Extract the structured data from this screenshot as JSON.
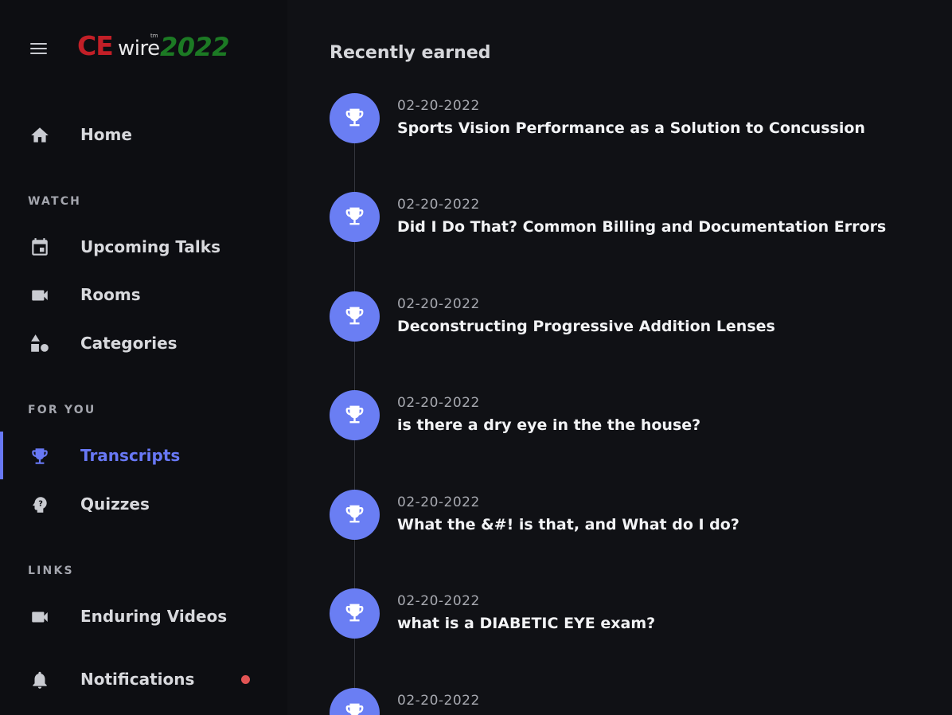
{
  "logo": {
    "ce": "CE",
    "wire": "wire",
    "tm": "tm",
    "year": "2022"
  },
  "sidebar": {
    "home": "Home",
    "sections": {
      "watch": "WATCH",
      "for_you": "FOR YOU",
      "links": "LINKS"
    },
    "items": {
      "upcoming": "Upcoming Talks",
      "rooms": "Rooms",
      "categories": "Categories",
      "transcripts": "Transcripts",
      "quizzes": "Quizzes",
      "enduring": "Enduring Videos",
      "notifications": "Notifications"
    },
    "active_item": "Transcripts",
    "icons": {
      "menu": "menu-icon",
      "home": "home-icon",
      "calendar": "calendar-icon",
      "video": "video-camera-icon",
      "categories": "shapes-icon",
      "trophy": "trophy-icon",
      "quiz": "question-head-icon",
      "bell": "bell-icon"
    }
  },
  "main": {
    "title": "Recently earned",
    "entries": [
      {
        "date": "02-20-2022",
        "title": "Sports Vision Performance as a Solution to Concussion"
      },
      {
        "date": "02-20-2022",
        "title": "Did I Do That? Common Billing and Documentation Errors"
      },
      {
        "date": "02-20-2022",
        "title": "Deconstructing Progressive Addition Lenses"
      },
      {
        "date": "02-20-2022",
        "title": "is there a dry eye in the the house?"
      },
      {
        "date": "02-20-2022",
        "title": "What the &#! is that, and What do I do?"
      },
      {
        "date": "02-20-2022",
        "title": "what is a DIABETIC EYE exam?"
      },
      {
        "date": "02-20-2022",
        "title": ""
      }
    ]
  },
  "colors": {
    "accent": "#6878f5",
    "badge": "#6a7ef3",
    "notification_dot": "#e25454",
    "background": "#101115",
    "sidebar": "#0d0e12"
  }
}
